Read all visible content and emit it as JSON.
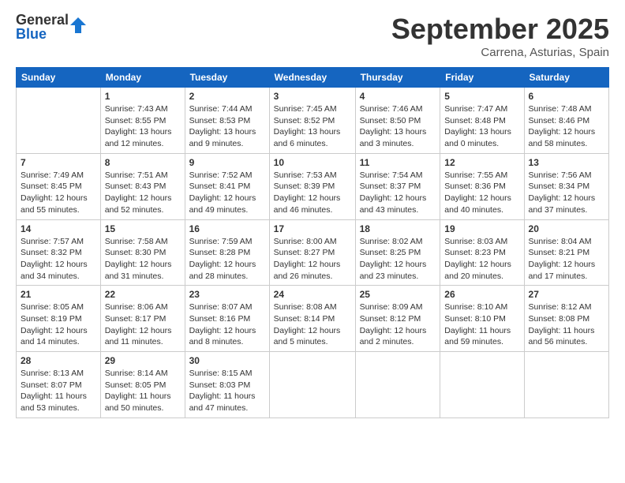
{
  "logo": {
    "general": "General",
    "blue": "Blue"
  },
  "title": "September 2025",
  "location": "Carrena, Asturias, Spain",
  "headers": [
    "Sunday",
    "Monday",
    "Tuesday",
    "Wednesday",
    "Thursday",
    "Friday",
    "Saturday"
  ],
  "weeks": [
    [
      {
        "day": "",
        "info": ""
      },
      {
        "day": "1",
        "info": "Sunrise: 7:43 AM\nSunset: 8:55 PM\nDaylight: 13 hours\nand 12 minutes."
      },
      {
        "day": "2",
        "info": "Sunrise: 7:44 AM\nSunset: 8:53 PM\nDaylight: 13 hours\nand 9 minutes."
      },
      {
        "day": "3",
        "info": "Sunrise: 7:45 AM\nSunset: 8:52 PM\nDaylight: 13 hours\nand 6 minutes."
      },
      {
        "day": "4",
        "info": "Sunrise: 7:46 AM\nSunset: 8:50 PM\nDaylight: 13 hours\nand 3 minutes."
      },
      {
        "day": "5",
        "info": "Sunrise: 7:47 AM\nSunset: 8:48 PM\nDaylight: 13 hours\nand 0 minutes."
      },
      {
        "day": "6",
        "info": "Sunrise: 7:48 AM\nSunset: 8:46 PM\nDaylight: 12 hours\nand 58 minutes."
      }
    ],
    [
      {
        "day": "7",
        "info": "Sunrise: 7:49 AM\nSunset: 8:45 PM\nDaylight: 12 hours\nand 55 minutes."
      },
      {
        "day": "8",
        "info": "Sunrise: 7:51 AM\nSunset: 8:43 PM\nDaylight: 12 hours\nand 52 minutes."
      },
      {
        "day": "9",
        "info": "Sunrise: 7:52 AM\nSunset: 8:41 PM\nDaylight: 12 hours\nand 49 minutes."
      },
      {
        "day": "10",
        "info": "Sunrise: 7:53 AM\nSunset: 8:39 PM\nDaylight: 12 hours\nand 46 minutes."
      },
      {
        "day": "11",
        "info": "Sunrise: 7:54 AM\nSunset: 8:37 PM\nDaylight: 12 hours\nand 43 minutes."
      },
      {
        "day": "12",
        "info": "Sunrise: 7:55 AM\nSunset: 8:36 PM\nDaylight: 12 hours\nand 40 minutes."
      },
      {
        "day": "13",
        "info": "Sunrise: 7:56 AM\nSunset: 8:34 PM\nDaylight: 12 hours\nand 37 minutes."
      }
    ],
    [
      {
        "day": "14",
        "info": "Sunrise: 7:57 AM\nSunset: 8:32 PM\nDaylight: 12 hours\nand 34 minutes."
      },
      {
        "day": "15",
        "info": "Sunrise: 7:58 AM\nSunset: 8:30 PM\nDaylight: 12 hours\nand 31 minutes."
      },
      {
        "day": "16",
        "info": "Sunrise: 7:59 AM\nSunset: 8:28 PM\nDaylight: 12 hours\nand 28 minutes."
      },
      {
        "day": "17",
        "info": "Sunrise: 8:00 AM\nSunset: 8:27 PM\nDaylight: 12 hours\nand 26 minutes."
      },
      {
        "day": "18",
        "info": "Sunrise: 8:02 AM\nSunset: 8:25 PM\nDaylight: 12 hours\nand 23 minutes."
      },
      {
        "day": "19",
        "info": "Sunrise: 8:03 AM\nSunset: 8:23 PM\nDaylight: 12 hours\nand 20 minutes."
      },
      {
        "day": "20",
        "info": "Sunrise: 8:04 AM\nSunset: 8:21 PM\nDaylight: 12 hours\nand 17 minutes."
      }
    ],
    [
      {
        "day": "21",
        "info": "Sunrise: 8:05 AM\nSunset: 8:19 PM\nDaylight: 12 hours\nand 14 minutes."
      },
      {
        "day": "22",
        "info": "Sunrise: 8:06 AM\nSunset: 8:17 PM\nDaylight: 12 hours\nand 11 minutes."
      },
      {
        "day": "23",
        "info": "Sunrise: 8:07 AM\nSunset: 8:16 PM\nDaylight: 12 hours\nand 8 minutes."
      },
      {
        "day": "24",
        "info": "Sunrise: 8:08 AM\nSunset: 8:14 PM\nDaylight: 12 hours\nand 5 minutes."
      },
      {
        "day": "25",
        "info": "Sunrise: 8:09 AM\nSunset: 8:12 PM\nDaylight: 12 hours\nand 2 minutes."
      },
      {
        "day": "26",
        "info": "Sunrise: 8:10 AM\nSunset: 8:10 PM\nDaylight: 11 hours\nand 59 minutes."
      },
      {
        "day": "27",
        "info": "Sunrise: 8:12 AM\nSunset: 8:08 PM\nDaylight: 11 hours\nand 56 minutes."
      }
    ],
    [
      {
        "day": "28",
        "info": "Sunrise: 8:13 AM\nSunset: 8:07 PM\nDaylight: 11 hours\nand 53 minutes."
      },
      {
        "day": "29",
        "info": "Sunrise: 8:14 AM\nSunset: 8:05 PM\nDaylight: 11 hours\nand 50 minutes."
      },
      {
        "day": "30",
        "info": "Sunrise: 8:15 AM\nSunset: 8:03 PM\nDaylight: 11 hours\nand 47 minutes."
      },
      {
        "day": "",
        "info": ""
      },
      {
        "day": "",
        "info": ""
      },
      {
        "day": "",
        "info": ""
      },
      {
        "day": "",
        "info": ""
      }
    ]
  ]
}
